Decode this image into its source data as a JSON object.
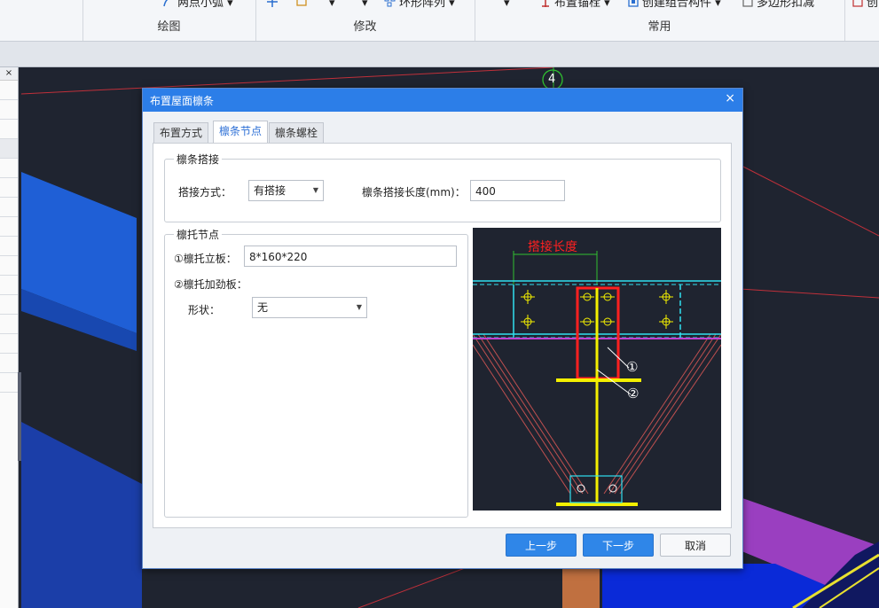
{
  "ribbon": {
    "items": [
      "两点小弧",
      "环形阵列",
      "布置锚栓",
      "创建组合构件",
      "多边形扣减",
      "创"
    ],
    "groups": [
      "绘图",
      "修改",
      "常用"
    ]
  },
  "canvas": {
    "axis_label": "4"
  },
  "dialog": {
    "title": "布置屋面檩条",
    "close_glyph": "×",
    "tabs": [
      "布置方式",
      "檩条节点",
      "檩条螺栓"
    ],
    "active_tab": 1,
    "lap_group": {
      "legend": "檩条搭接",
      "mode_label": "搭接方式：",
      "mode_value": "有搭接",
      "length_label": "檩条搭接长度(mm)：",
      "length_value": "400"
    },
    "bracket_group": {
      "legend": "檩托节点",
      "plate_label": "①檩托立板：",
      "plate_value": "8*160*220",
      "stiffener_label": "②檩托加劲板：",
      "shape_label": "形状：",
      "shape_value": "无"
    },
    "preview": {
      "dim_label": "搭接长度",
      "marker_1": "①",
      "marker_2": "②"
    },
    "buttons": {
      "prev": "上一步",
      "next": "下一步",
      "cancel": "取消"
    }
  },
  "colors": {
    "title_bar": "#2c7ee8",
    "primary_button": "#2f86e8",
    "canvas_bg": "#1f2430",
    "cad_red": "#ff2020",
    "cad_cyan": "#30e0f0",
    "cad_yellow": "#f4f000",
    "cad_green": "#30c030"
  }
}
